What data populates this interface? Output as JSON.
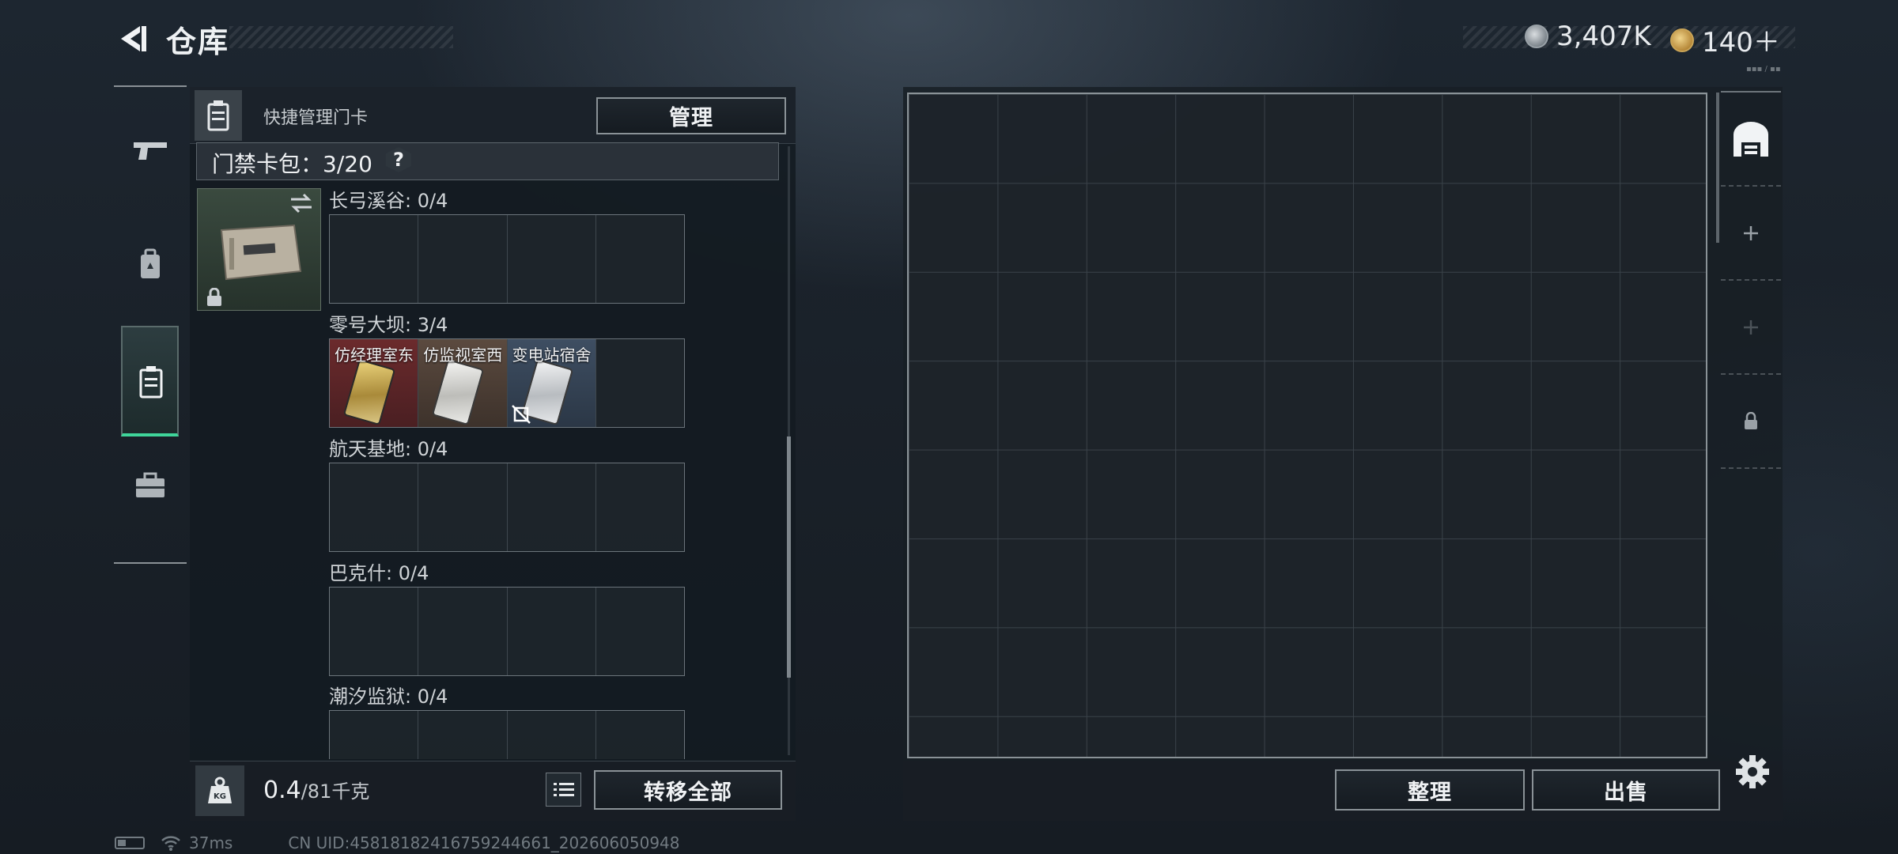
{
  "header": {
    "title": "仓库"
  },
  "currency": [
    {
      "icon": "silver-coin-icon",
      "value": "3,407K"
    },
    {
      "icon": "gold-coin-icon",
      "value": "140＋"
    }
  ],
  "quick_manage": {
    "label": "快捷管理门卡",
    "button": "管理"
  },
  "keybag": {
    "title": "门禁卡包：3/20",
    "help": "?",
    "areas": [
      {
        "name": "长弓溪谷: 0/4",
        "cards": []
      },
      {
        "name": "零号大坝: 3/4",
        "cards": [
          "仿经理室东",
          "仿监视室西",
          "变电站宿舍"
        ]
      },
      {
        "name": "航天基地: 0/4",
        "cards": []
      },
      {
        "name": "巴克什: 0/4",
        "cards": []
      },
      {
        "name": "潮汐监狱: 0/4",
        "cards": []
      }
    ]
  },
  "footer_left": {
    "weight": "0.4",
    "capacity": "/81千克",
    "transfer_button": "转移全部"
  },
  "footer_right": {
    "sort_button": "整理",
    "sell_button": "出售"
  },
  "status_bar": {
    "ping": "37ms",
    "uid": "CN UID:4581818241675924466​1_202606050948"
  },
  "colors": {
    "accent_green": "#3fd59a",
    "card_red": "#6b2a2c",
    "card_brown": "#5b4a3f",
    "card_blue": "#3e4e62"
  }
}
